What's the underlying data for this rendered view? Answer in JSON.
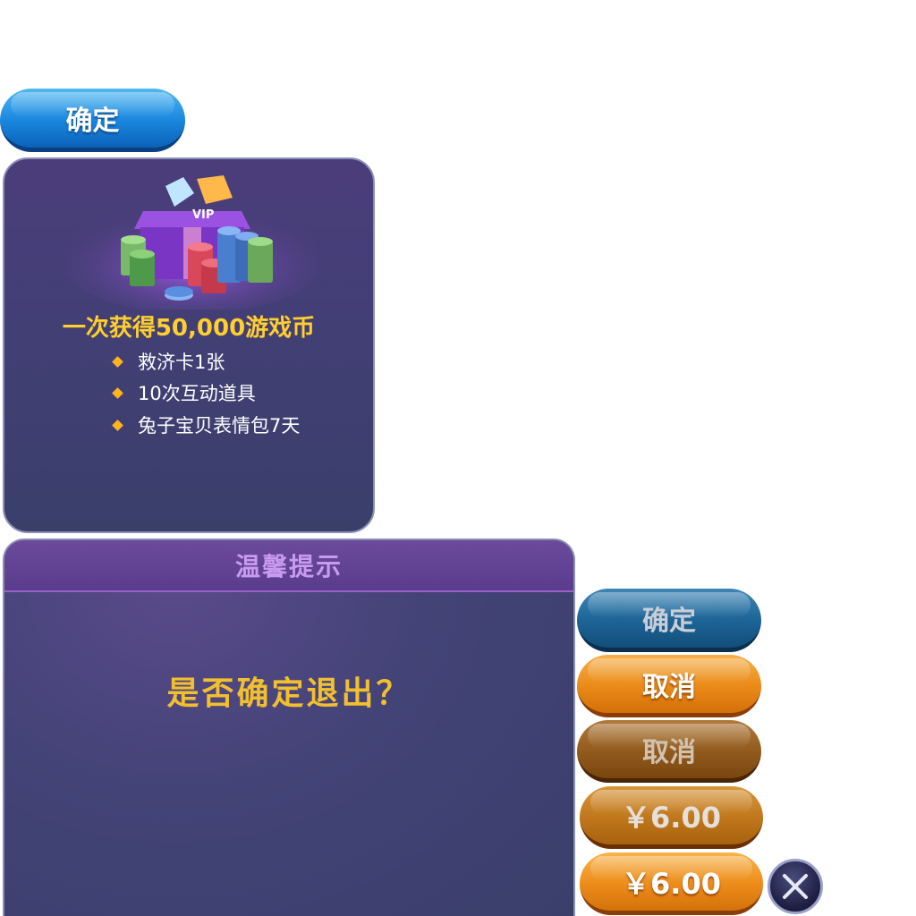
{
  "top_confirm": {
    "label": "确定"
  },
  "vip_panel": {
    "headline": "一次获得50,000游戏币",
    "badge_text": "VIP",
    "perks": [
      "救济卡1张",
      "10次互动道具",
      "兔子宝贝表情包7天"
    ]
  },
  "dialog": {
    "title": "温馨提示",
    "message": "是否确定退出？"
  },
  "buttons": {
    "confirm_disabled": "确定",
    "cancel": "取消",
    "cancel_pressed": "取消",
    "price_pressed": "￥6.00",
    "price": "￥6.00"
  },
  "colors": {
    "gold_text": "#ffcf2e",
    "panel_bg": "#3a3f6a",
    "orange": "#ec8c1a",
    "blue": "#1a86de"
  }
}
